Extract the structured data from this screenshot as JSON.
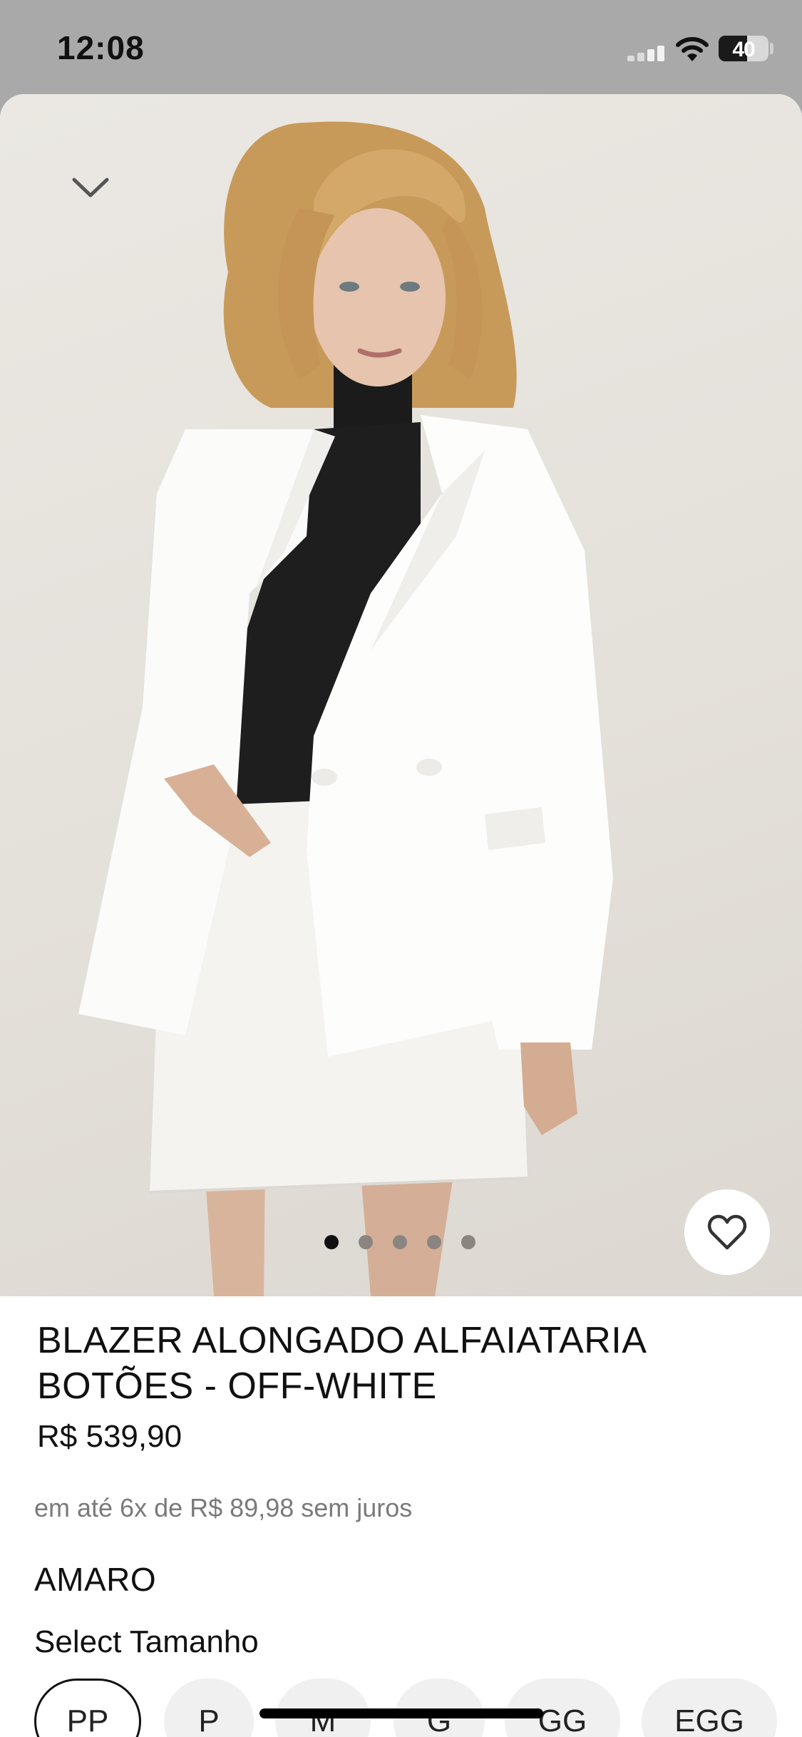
{
  "status_bar": {
    "time": "12:08",
    "battery": "40"
  },
  "product": {
    "image_alt": "Model wearing off-white tailored blazer with black knit top and white denim skirt",
    "carousel_dots": 5,
    "active_dot": 0,
    "title": "BLAZER ALONGADO ALFAIATARIA BOTÕES - OFF-WHITE",
    "price": "R$ 539,90",
    "installments": "em até 6x de R$ 89,98 sem juros",
    "brand": "AMARO"
  },
  "sizes": {
    "label": "Select Tamanho",
    "options": [
      "PP",
      "P",
      "M",
      "G",
      "GG",
      "EGG"
    ],
    "selected": "PP"
  },
  "colors": {
    "status_bar_bg": "#a9a9a9",
    "text": "#111111",
    "muted": "#7a7a7a"
  },
  "icons": {
    "collapse": "chevron-down-icon",
    "favorite": "heart-outline-icon"
  }
}
